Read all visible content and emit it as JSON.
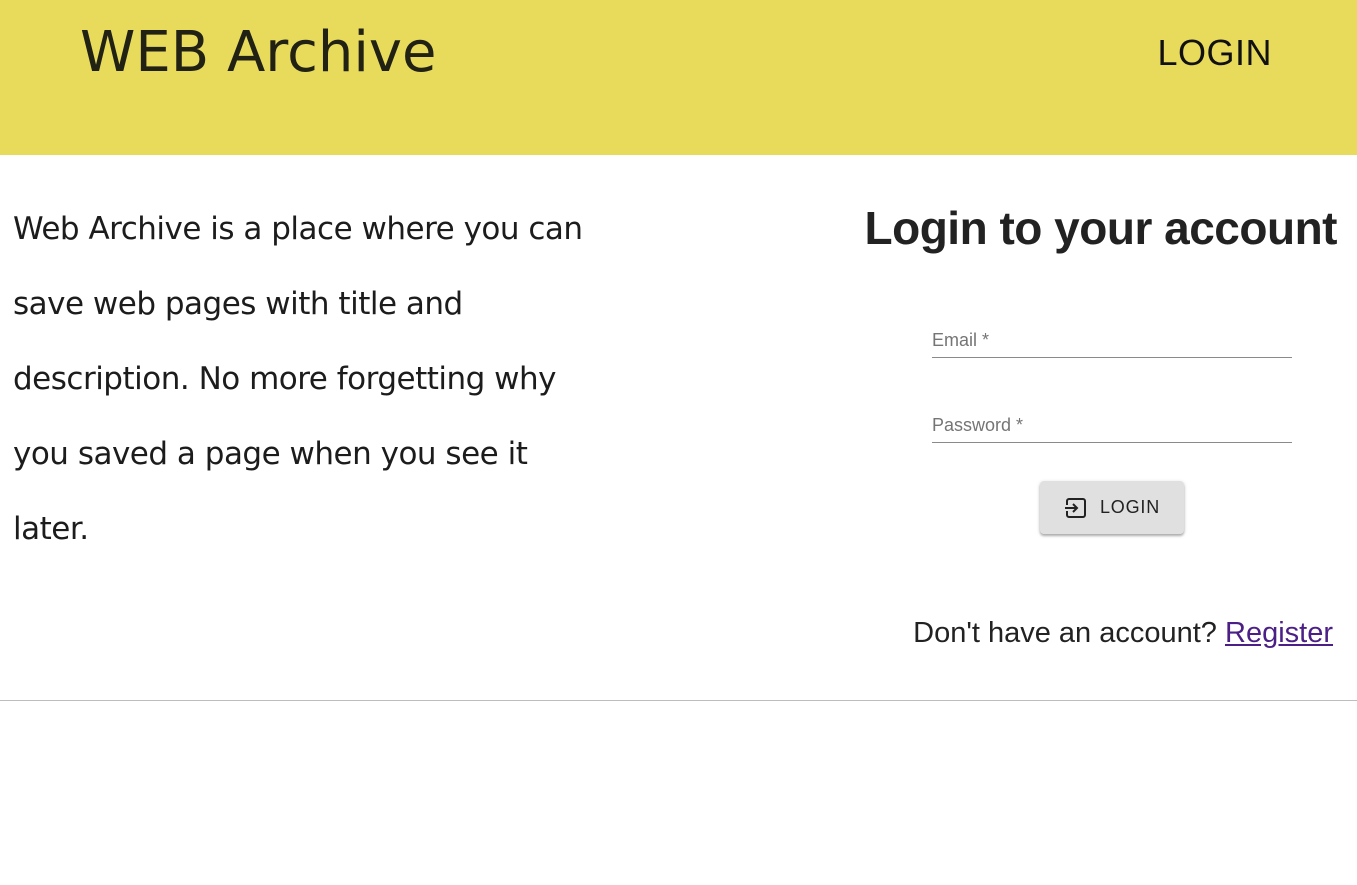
{
  "header": {
    "brand": "WEB Archive",
    "nav_login": "LOGIN",
    "background_color": "#e8db5c"
  },
  "intro": {
    "text": "Web Archive is a place where you can save web pages with title and description. No more forgetting why you saved a page when you see it later."
  },
  "login": {
    "title": "Login to your account",
    "email_label": "Email *",
    "email_value": "",
    "password_label": "Password *",
    "password_value": "",
    "button_label": "LOGIN",
    "button_icon": "login-icon",
    "register_prompt": "Don't have an account?",
    "register_link": "Register",
    "link_color": "#4b1f86"
  }
}
